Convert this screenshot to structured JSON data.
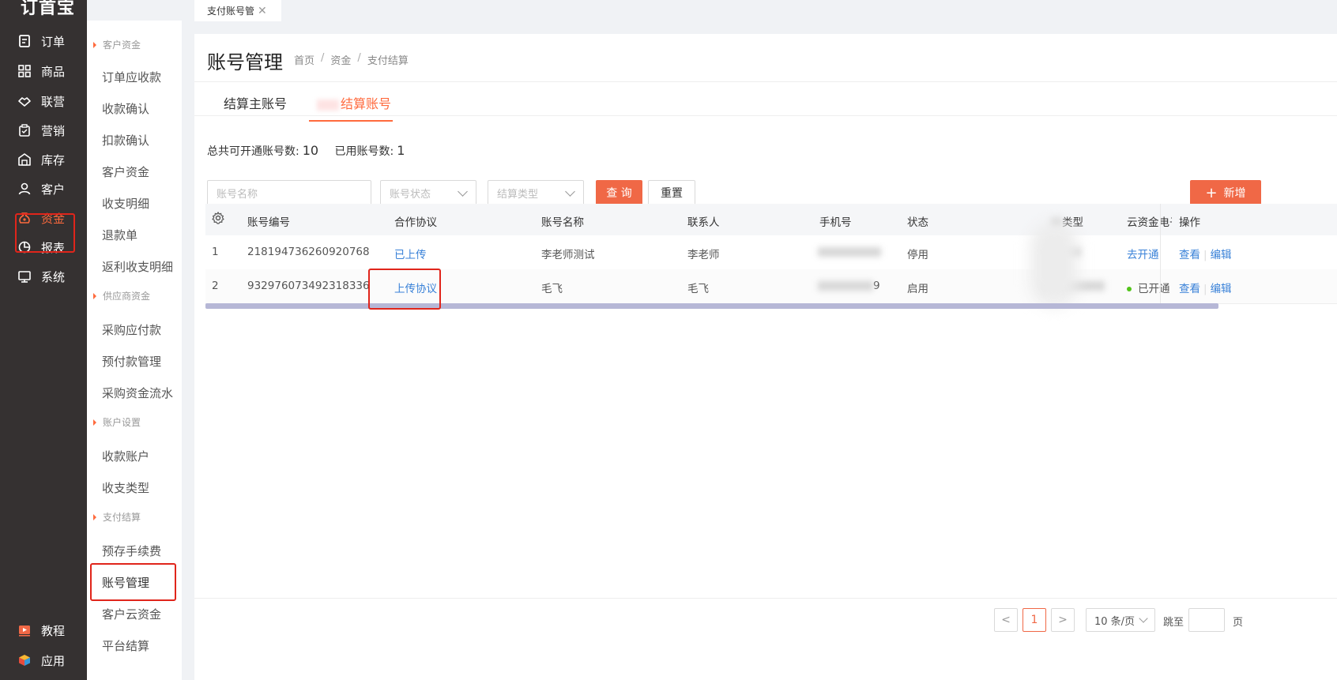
{
  "app": {
    "logo": "订首宝"
  },
  "nav": [
    {
      "label": "订单",
      "icon": "order-icon"
    },
    {
      "label": "商品",
      "icon": "grid-icon"
    },
    {
      "label": "联营",
      "icon": "handshake-icon"
    },
    {
      "label": "营销",
      "icon": "clipboard-icon"
    },
    {
      "label": "库存",
      "icon": "warehouse-icon"
    },
    {
      "label": "客户",
      "icon": "user-icon"
    },
    {
      "label": "资金",
      "icon": "money-bag-icon",
      "active": true
    },
    {
      "label": "报表",
      "icon": "pie-chart-icon"
    },
    {
      "label": "系统",
      "icon": "monitor-icon"
    }
  ],
  "nav_bottom": [
    {
      "label": "教程",
      "icon": "video-icon"
    },
    {
      "label": "应用",
      "icon": "cube-icon"
    }
  ],
  "submenu": {
    "groups": [
      "客户资金",
      "供应商资金",
      "账户设置",
      "支付结算"
    ],
    "items": [
      "订单应收款",
      "收款确认",
      "扣款确认",
      "客户资金",
      "收支明细",
      "退款单",
      "返利收支明细",
      "采购应付款",
      "预付款管理",
      "采购资金流水",
      "收款账户",
      "收支类型",
      "预存手续费",
      "账号管理",
      "客户云资金",
      "平台结算"
    ]
  },
  "tabbar": {
    "tab_label": "支付账号管",
    "close": "✕"
  },
  "page": {
    "title": "账号管理",
    "breadcrumb": [
      "首页",
      "资金",
      "支付结算"
    ],
    "tabs": [
      "结算主账号",
      "结算账号"
    ],
    "total_label": "总共可开通账号数:",
    "total_value": "10",
    "used_label": "已用账号数:",
    "used_value": "1"
  },
  "filters": {
    "account_name_placeholder": "账号名称",
    "account_status_placeholder": "账号状态",
    "settle_type_placeholder": "结算类型",
    "query": "查 询",
    "reset": "重置",
    "add": "新增"
  },
  "table": {
    "columns": [
      "账号编号",
      "合作协议",
      "账号名称",
      "联系人",
      "手机号",
      "状态",
      "类型",
      "云资金电子",
      "操作"
    ],
    "rows": [
      {
        "index": "1",
        "account_no": "218194736260920768",
        "agreement": "已上传",
        "name": "李老师测试",
        "contact": "李老师",
        "phone_tail": "",
        "status": "停用",
        "cloud": "去开通",
        "view": "查看",
        "edit": "编辑"
      },
      {
        "index": "2",
        "account_no": "932976073492318336",
        "agreement": "上传协议",
        "name": "毛飞",
        "contact": "毛飞",
        "phone_tail": "9",
        "status": "启用",
        "cloud": "已开通",
        "view": "查看",
        "edit": "编辑"
      }
    ]
  },
  "pagination": {
    "prev": "<",
    "current": "1",
    "next": ">",
    "page_size": "10 条/页",
    "jump_label": "跳至",
    "page_suffix": "页"
  },
  "colors": {
    "accent": "#f06846",
    "nav_bg": "#353131",
    "link": "#3a82d8",
    "highlight_box": "#e0251b"
  }
}
